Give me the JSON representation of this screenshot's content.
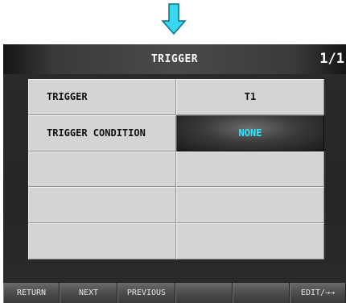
{
  "screen": {
    "title": "TRIGGER",
    "page_indicator": "1/1"
  },
  "settings_table": {
    "rows": [
      {
        "label": "TRIGGER",
        "value": "T1"
      },
      {
        "label": "TRIGGER CONDITION",
        "value": "NONE"
      },
      {
        "label": "",
        "value": ""
      },
      {
        "label": "",
        "value": ""
      },
      {
        "label": "",
        "value": ""
      }
    ]
  },
  "function_keys": {
    "return": "RETURN",
    "next": "NEXT",
    "previous": "PREVIOUS",
    "blank1": "",
    "blank2": "",
    "edit": "EDIT/→→"
  },
  "colors": {
    "arrow": "#38d6f0",
    "selected_value_text": "#2ee8ff",
    "cell_background": "#d4d4d4"
  }
}
